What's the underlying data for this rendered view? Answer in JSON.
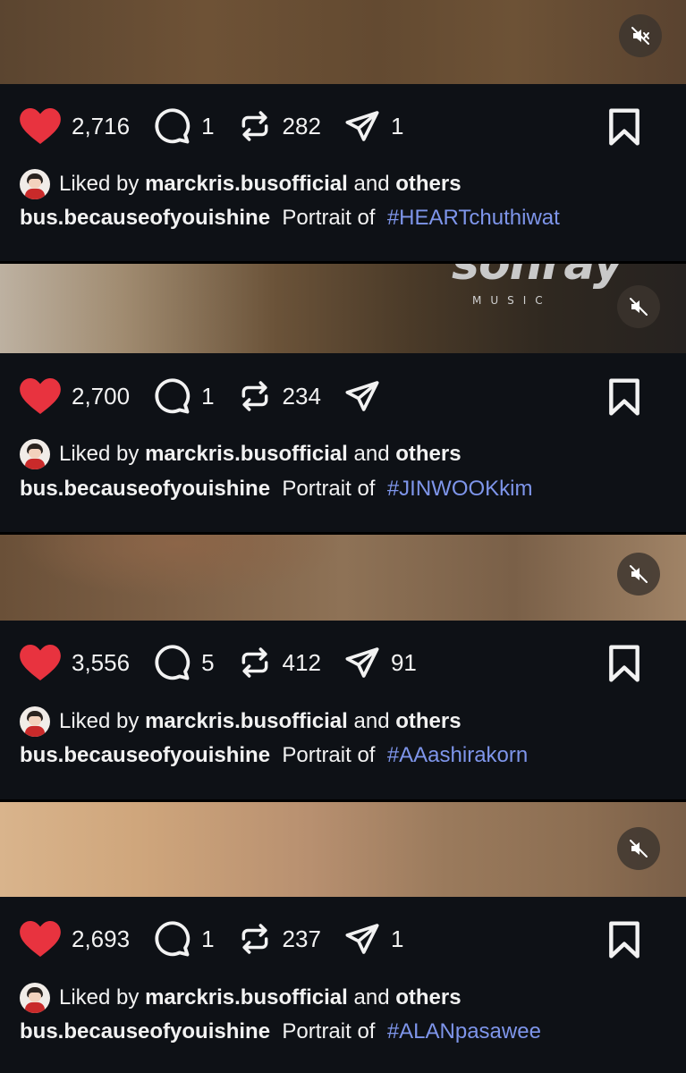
{
  "icons": {
    "like": "heart-icon",
    "comment": "comment-bubble-icon",
    "repost": "repost-icon",
    "share": "send-icon",
    "save": "bookmark-icon",
    "mute": "speaker-muted-icon"
  },
  "colors": {
    "background": "#0e1116",
    "like_red": "#e8333f",
    "hashtag": "#7e95ea",
    "text": "#f2f2f2"
  },
  "liked_by": {
    "prefix": "Liked by",
    "user": "marckris.busofficial",
    "joiner": "and",
    "others": "others"
  },
  "posts": [
    {
      "likes": "2,716",
      "comments": "1",
      "reposts": "282",
      "shares": "1",
      "author": "bus.becauseofyouishine",
      "caption_text": "Portrait of",
      "hashtag": "#HEARTchuthiwat"
    },
    {
      "likes": "2,700",
      "comments": "1",
      "reposts": "234",
      "shares": "",
      "author": "bus.becauseofyouishine",
      "caption_text": "Portrait of",
      "hashtag": "#JINWOOKkim",
      "media_brand": "sonray",
      "media_brand_sub": "MUSIC"
    },
    {
      "likes": "3,556",
      "comments": "5",
      "reposts": "412",
      "shares": "91",
      "author": "bus.becauseofyouishine",
      "caption_text": "Portrait of",
      "hashtag": "#AAashirakorn"
    },
    {
      "likes": "2,693",
      "comments": "1",
      "reposts": "237",
      "shares": "1",
      "author": "bus.becauseofyouishine",
      "caption_text": "Portrait of",
      "hashtag": "#ALANpasawee"
    }
  ]
}
